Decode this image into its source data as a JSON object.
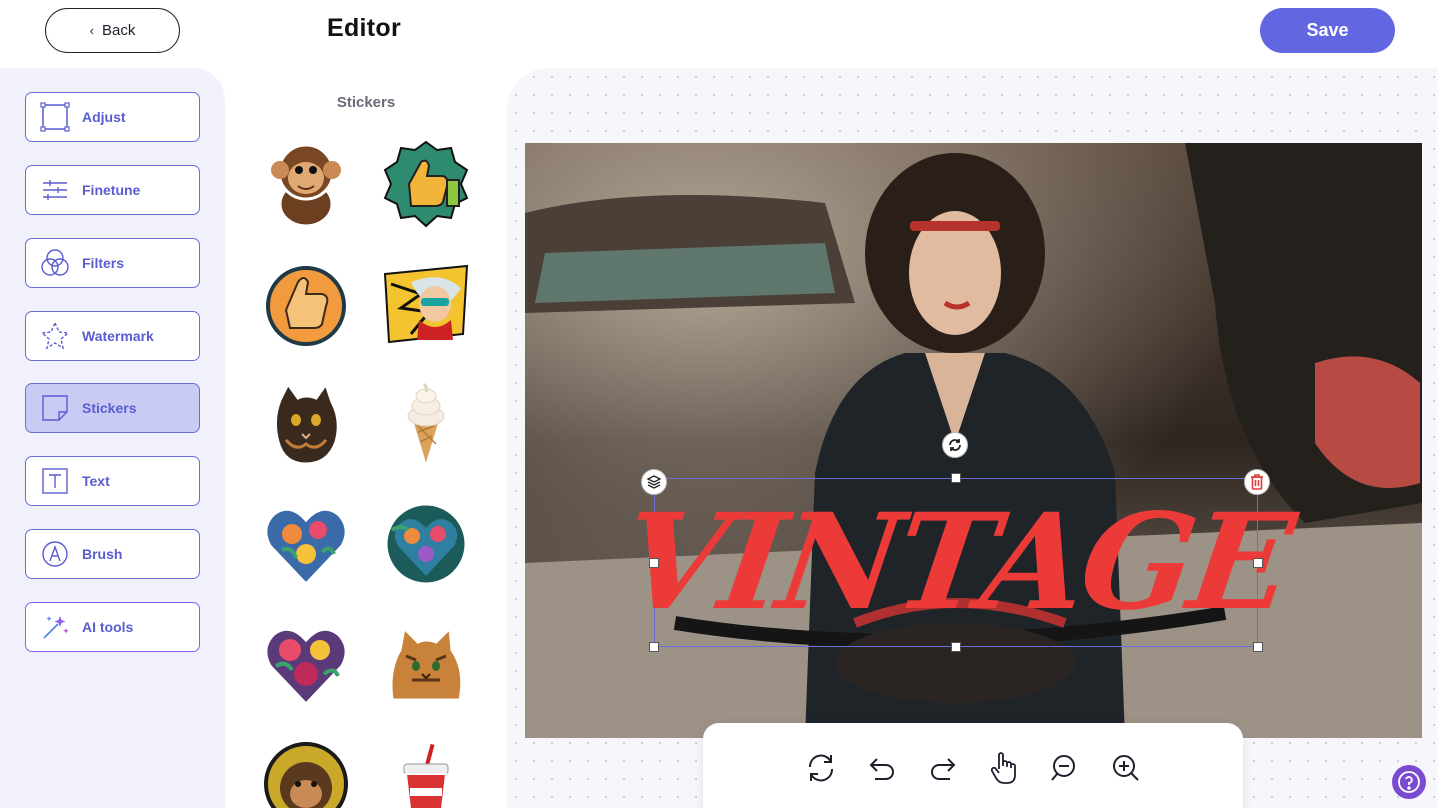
{
  "header": {
    "back_label": "Back",
    "title": "Editor",
    "save_label": "Save"
  },
  "tools": [
    {
      "label": "Adjust",
      "icon": "crop-frame-icon"
    },
    {
      "label": "Finetune",
      "icon": "sliders-icon"
    },
    {
      "label": "Filters",
      "icon": "circles-icon"
    },
    {
      "label": "Watermark",
      "icon": "star-outline-icon"
    },
    {
      "label": "Stickers",
      "icon": "sticker-icon",
      "active": true
    },
    {
      "label": "Text",
      "icon": "text-box-icon"
    },
    {
      "label": "Brush",
      "icon": "brush-icon"
    },
    {
      "label": "AI tools",
      "icon": "magic-wand-icon"
    }
  ],
  "stickers_panel": {
    "title": "Stickers",
    "items": [
      "monkey-sticker",
      "thumbs-up-badge-sticker",
      "thumbs-up-circle-sticker",
      "pop-art-woman-sticker",
      "cat-sticker",
      "ice-cream-cone-sticker",
      "floral-heart-sticker",
      "floral-heart-circle-sticker",
      "flower-heart-sticker",
      "tabby-cat-sticker",
      "monkey-circle-sticker",
      "soda-cup-sticker"
    ]
  },
  "canvas": {
    "overlay_text": "VINTAGE",
    "overlay_color": "#ec3a38"
  },
  "toolbar": [
    "reset-icon",
    "undo-icon",
    "redo-icon",
    "pan-hand-icon",
    "zoom-out-icon",
    "zoom-in-icon"
  ],
  "colors": {
    "accent": "#6366e1",
    "active_tool_bg": "#c9cbf4",
    "help": "#7a4bd0"
  }
}
